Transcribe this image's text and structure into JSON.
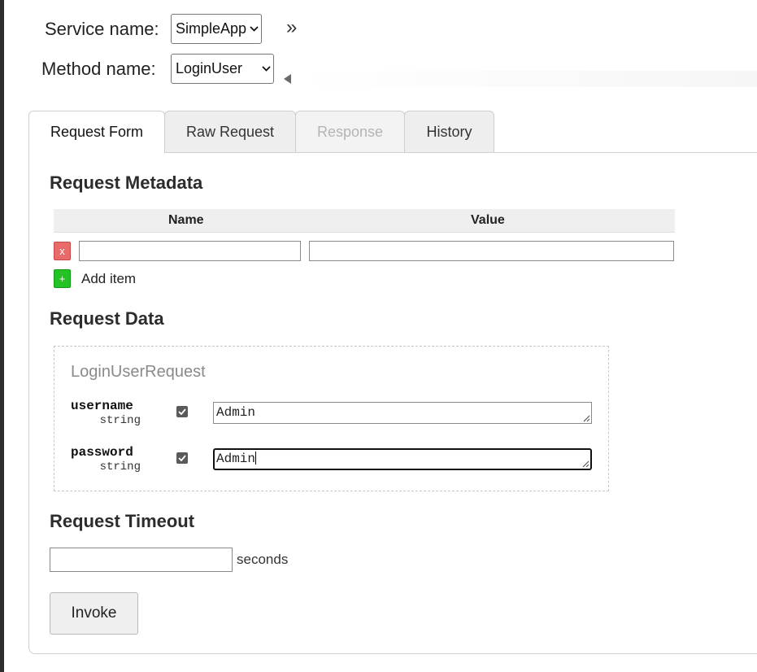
{
  "header": {
    "service_label": "Service name:",
    "service_value": "SimpleApp",
    "method_label": "Method name:",
    "method_value": "LoginUser",
    "expand_glyph": "»"
  },
  "tabs": [
    {
      "label": "Request Form",
      "state": "active"
    },
    {
      "label": "Raw Request",
      "state": "normal"
    },
    {
      "label": "Response",
      "state": "disabled"
    },
    {
      "label": "History",
      "state": "normal"
    }
  ],
  "metadata": {
    "title": "Request Metadata",
    "columns": [
      "Name",
      "Value"
    ],
    "rows": [
      {
        "name": "",
        "value": ""
      }
    ],
    "delete_glyph": "x",
    "add_glyph": "+",
    "add_label": "Add item"
  },
  "request_data": {
    "title": "Request Data",
    "message_type": "LoginUserRequest",
    "fields": [
      {
        "name": "username",
        "type": "string",
        "checked": true,
        "value": "Admin"
      },
      {
        "name": "password",
        "type": "string",
        "checked": true,
        "value": "Admin"
      }
    ]
  },
  "timeout": {
    "title": "Request Timeout",
    "value": "",
    "unit": "seconds"
  },
  "invoke_label": "Invoke",
  "icons": {
    "expand": "double-chevron-right-icon",
    "collapse": "triangle-left-icon",
    "dropdown": "chevron-down-icon",
    "check": "checkmark-icon"
  },
  "colors": {
    "delete_button": "#e86a6a",
    "add_button": "#22c322",
    "active_tab": "#ffffff",
    "inactive_tab": "#eeeeee"
  }
}
